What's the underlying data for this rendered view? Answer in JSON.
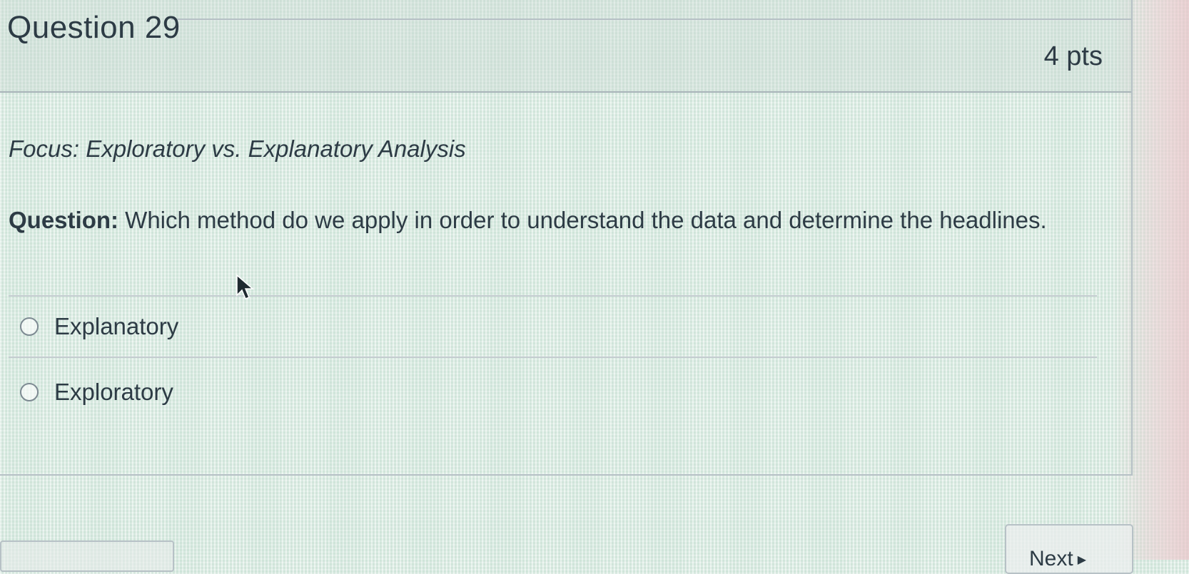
{
  "question": {
    "title": "Question 29",
    "points": "4 pts",
    "focus": "Focus: Exploratory vs. Explanatory Analysis",
    "prompt_label": "Question:",
    "prompt_text": " Which method do we apply in order to understand the data and determine the headlines."
  },
  "answers": [
    {
      "label": "Explanatory"
    },
    {
      "label": "Exploratory"
    }
  ],
  "navigation": {
    "next_label": "Next",
    "next_icon": "triangle-right-icon"
  }
}
